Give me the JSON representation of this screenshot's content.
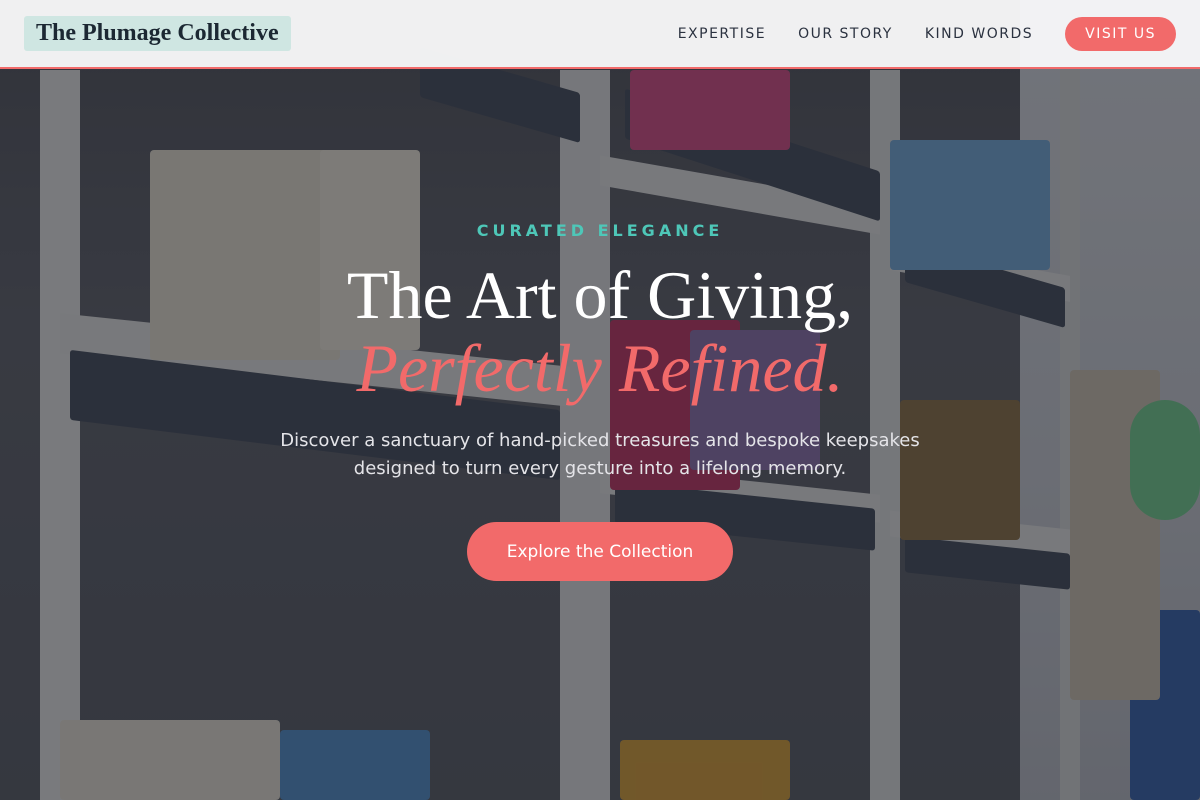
{
  "header": {
    "logo": "The Plumage Collective",
    "nav": [
      "EXPERTISE",
      "OUR STORY",
      "KIND WORDS"
    ],
    "visit_label": "VISIT US"
  },
  "hero": {
    "eyebrow": "CURATED ELEGANCE",
    "headline": "The Art of Giving,",
    "headline_accent": "Perfectly Refined.",
    "subtitle": "Discover a sanctuary of hand-picked treasures and bespoke keepsakes designed to turn every gesture into a lifelong memory.",
    "cta_label": "Explore the Collection"
  },
  "colors": {
    "accent": "#f26a6a",
    "teal": "#4ec7b8",
    "logo_bg": "#cfe6e2"
  }
}
